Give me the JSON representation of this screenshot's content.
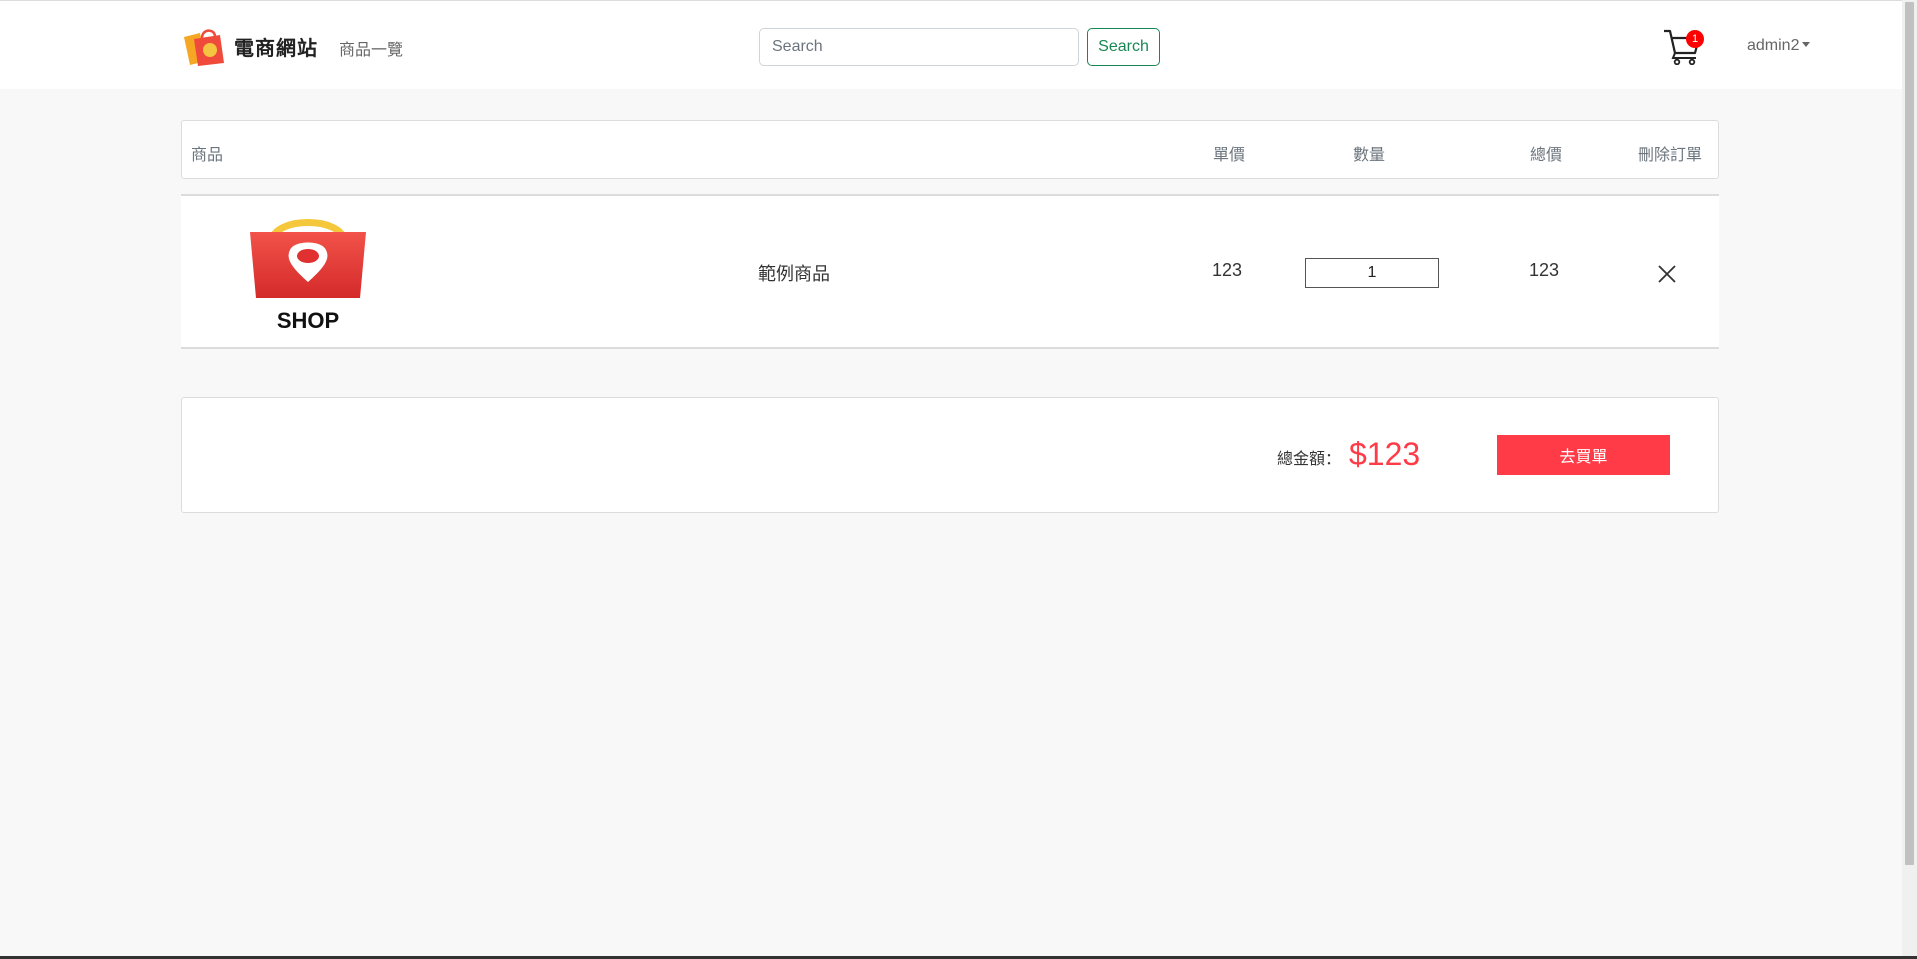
{
  "navbar": {
    "brand_name": "電商網站",
    "nav_link": "商品一覽",
    "search_placeholder": "Search",
    "search_button": "Search",
    "cart_count": "1",
    "user_name": "admin2"
  },
  "table": {
    "headers": {
      "product": "商品",
      "unit_price": "單價",
      "quantity": "數量",
      "subtotal": "總價",
      "delete": "刪除訂單"
    },
    "rows": [
      {
        "image_text": "SHOP",
        "name": "範例商品",
        "unit_price": "123",
        "quantity": "1",
        "subtotal": "123"
      }
    ]
  },
  "summary": {
    "total_label": "總金額：",
    "total_value": "$123",
    "checkout_button": "去買單"
  },
  "colors": {
    "accent": "#ff3b47",
    "success": "#198754",
    "badge": "#ff0000"
  }
}
